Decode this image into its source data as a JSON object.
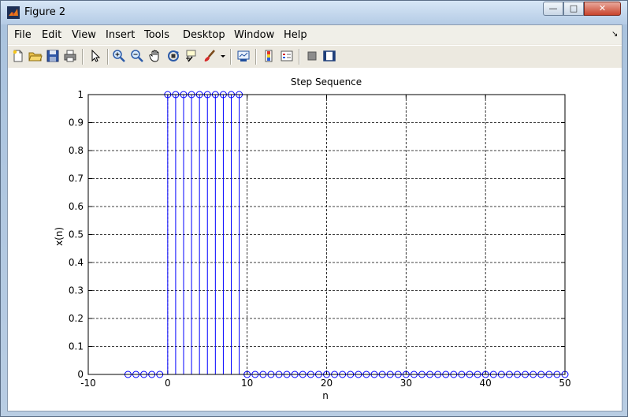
{
  "window": {
    "title": "Figure 2",
    "minimize_glyph": "—",
    "maximize_glyph": "□",
    "close_glyph": "✕"
  },
  "menu": {
    "items": [
      "File",
      "Edit",
      "View",
      "Insert",
      "Tools",
      "Desktop",
      "Window",
      "Help"
    ],
    "overflow_glyph": "↘"
  },
  "toolbar": {
    "icons": [
      "new-figure-icon",
      "open-file-icon",
      "save-icon",
      "print-icon",
      "edit-plot-icon",
      "zoom-in-icon",
      "zoom-out-icon",
      "pan-icon",
      "rotate-3d-icon",
      "data-cursor-icon",
      "brush-icon",
      "brush-dropdown-icon",
      "link-plot-icon",
      "insert-colorbar-icon",
      "insert-legend-icon",
      "hide-plot-tools-icon",
      "show-plot-tools-icon"
    ]
  },
  "chart_data": {
    "type": "stem",
    "title": "Step Sequence",
    "xlabel": "n",
    "ylabel": "x(n)",
    "xlim": [
      -10,
      50
    ],
    "ylim": [
      0,
      1
    ],
    "xticks": [
      -10,
      0,
      10,
      20,
      30,
      40,
      50
    ],
    "yticks": [
      0,
      0.1,
      0.2,
      0.3,
      0.4,
      0.5,
      0.6,
      0.7,
      0.8,
      0.9,
      1
    ],
    "grid": true,
    "color": "#0000ff",
    "series": [
      {
        "x": [
          -5,
          -4,
          -3,
          -2,
          -1,
          0,
          1,
          2,
          3,
          4,
          5,
          6,
          7,
          8,
          9,
          10,
          11,
          12,
          13,
          14,
          15,
          16,
          17,
          18,
          19,
          20,
          21,
          22,
          23,
          24,
          25,
          26,
          27,
          28,
          29,
          30,
          31,
          32,
          33,
          34,
          35,
          36,
          37,
          38,
          39,
          40,
          41,
          42,
          43,
          44,
          45,
          46,
          47,
          48,
          49,
          50
        ],
        "y": [
          0,
          0,
          0,
          0,
          0,
          1,
          1,
          1,
          1,
          1,
          1,
          1,
          1,
          1,
          1,
          0,
          0,
          0,
          0,
          0,
          0,
          0,
          0,
          0,
          0,
          0,
          0,
          0,
          0,
          0,
          0,
          0,
          0,
          0,
          0,
          0,
          0,
          0,
          0,
          0,
          0,
          0,
          0,
          0,
          0,
          0,
          0,
          0,
          0,
          0,
          0,
          0,
          0,
          0,
          0,
          0
        ]
      }
    ]
  }
}
